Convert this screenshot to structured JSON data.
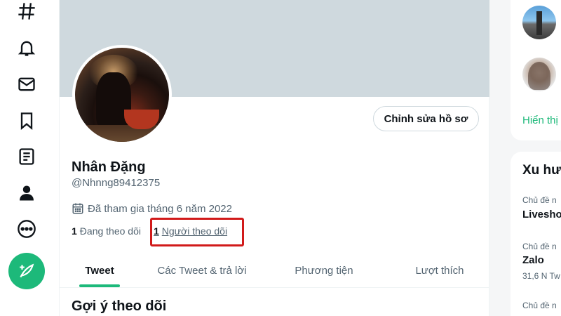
{
  "profile": {
    "name": "Nhân Đặng",
    "handle": "@Nhnng89412375",
    "joined": "Đã tham gia tháng 6 năm 2022",
    "following_count": "1",
    "following_label": "Đang theo dõi",
    "followers_count": "1",
    "followers_label": "Người theo dõi",
    "edit_button": "Chỉnh sửa hồ sơ"
  },
  "tabs": [
    {
      "label": "Tweet",
      "active": true
    },
    {
      "label": "Các Tweet & trả lời",
      "active": false
    },
    {
      "label": "Phương tiện",
      "active": false
    },
    {
      "label": "Lượt thích",
      "active": false
    }
  ],
  "suggestions": {
    "title": "Gợi ý theo dõi"
  },
  "nav": {
    "icons": [
      "hashtag-icon",
      "bell-icon",
      "mail-icon",
      "bookmark-icon",
      "list-icon",
      "profile-icon",
      "more-icon"
    ],
    "tweet_button": "compose-tweet-icon"
  },
  "right_panel": {
    "show_more": "Hiển thị",
    "trends_title": "Xu hư",
    "trends": [
      {
        "context": "Chủ đề n",
        "name": "Livesho",
        "count": ""
      },
      {
        "context": "Chủ đề n",
        "name": "Zalo",
        "count": "31,6 N Tw"
      },
      {
        "context": "Chủ đề n",
        "name": "",
        "count": ""
      }
    ]
  },
  "colors": {
    "accent": "#1db97a",
    "highlight": "#d11a1a",
    "banner": "#cfd9de",
    "muted_text": "#536471"
  }
}
